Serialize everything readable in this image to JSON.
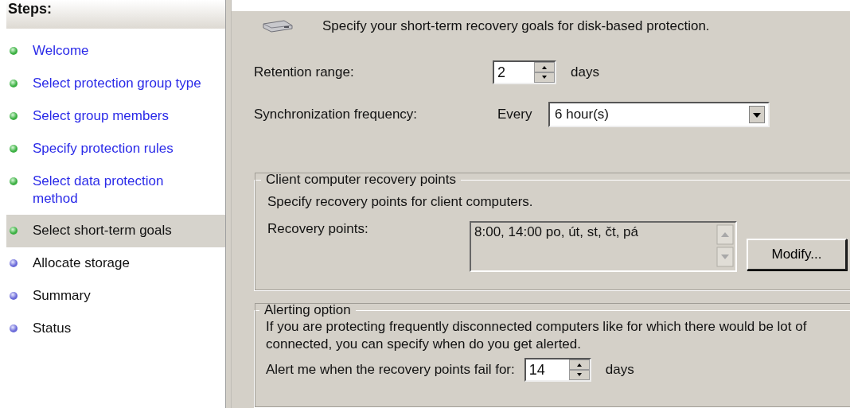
{
  "sidebar": {
    "title": "Steps:",
    "items": [
      {
        "label": "Welcome",
        "completed": true,
        "selected": false
      },
      {
        "label": "Select protection group type",
        "completed": true,
        "selected": false
      },
      {
        "label": "Select group members",
        "completed": true,
        "selected": false
      },
      {
        "label": "Specify protection rules",
        "completed": true,
        "selected": false
      },
      {
        "label": "Select data protection method",
        "completed": true,
        "selected": false
      },
      {
        "label": "Select short-term goals",
        "completed": true,
        "selected": true
      },
      {
        "label": "Allocate storage",
        "completed": false,
        "selected": false
      },
      {
        "label": "Summary",
        "completed": false,
        "selected": false
      },
      {
        "label": "Status",
        "completed": false,
        "selected": false
      }
    ]
  },
  "header": "Specify your short-term recovery goals for disk-based protection.",
  "retention": {
    "label": "Retention range:",
    "value": "2",
    "unit": "days"
  },
  "sync": {
    "label": "Synchronization frequency:",
    "prefix": "Every",
    "value": "6 hour(s)"
  },
  "client_group": {
    "title": "Client computer recovery points",
    "description": "Specify recovery points for client computers.",
    "label": "Recovery points:",
    "value": "8:00, 14:00 po, út, st, čt, pá",
    "button": "Modify..."
  },
  "alert_group": {
    "title": "Alerting option",
    "description": "If you are protecting frequently disconnected computers like for which there would be lot of",
    "description_2": "connected, you can specify when do you get alerted.",
    "label": "Alert me when the recovery points fail for:",
    "value": "14",
    "unit": "days"
  }
}
